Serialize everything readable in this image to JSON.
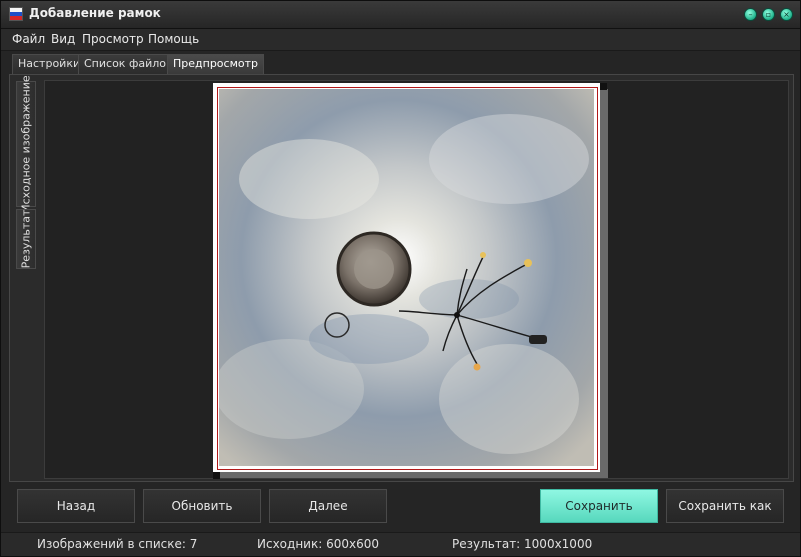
{
  "window": {
    "title": "Добавление рамок"
  },
  "menu": {
    "items": [
      "Файл",
      "Вид",
      "Просмотр",
      "Помощь"
    ]
  },
  "tabs": [
    {
      "label": "Настройки",
      "active": false
    },
    {
      "label": "Список файлов",
      "active": false
    },
    {
      "label": "Предпросмотр",
      "active": true
    }
  ],
  "side_tabs": [
    {
      "label": "Исходное изображение",
      "active": true
    },
    {
      "label": "Результат",
      "active": false
    }
  ],
  "preview": {
    "frame_color": "#ffffff",
    "inner_border_color": "#b21818",
    "shadow_color": "#6a6a6a"
  },
  "buttons": {
    "back": "Назад",
    "refresh": "Обновить",
    "next": "Далее",
    "save": "Сохранить",
    "save_as": "Сохранить как"
  },
  "status": {
    "images_count": "Изображений в списке: 7",
    "source": "Исходник: 600x600",
    "result": "Результат: 1000x1000"
  },
  "colors": {
    "accent": "#6ff0d6"
  }
}
